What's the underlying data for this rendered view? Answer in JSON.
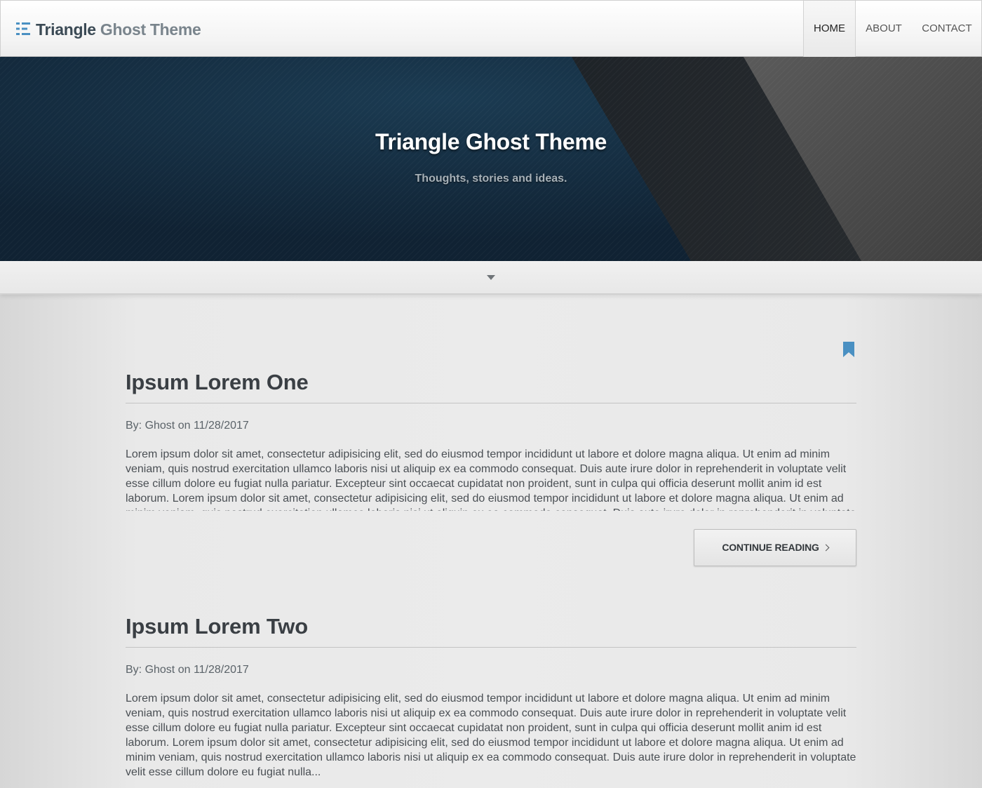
{
  "navbar": {
    "logo_text_dark": "Triangle",
    "logo_text_light": "Ghost Theme",
    "logo_icon": "list-icon",
    "items": [
      {
        "label": "HOME",
        "active": true
      },
      {
        "label": "ABOUT",
        "active": false
      },
      {
        "label": "CONTACT",
        "active": false
      }
    ]
  },
  "hero": {
    "title": "Triangle Ghost Theme",
    "subtitle": "Thoughts, stories and ideas.",
    "scroll_icon": "caret-down-icon"
  },
  "bookmark_icon": "bookmark-icon",
  "posts": [
    {
      "title": "Ipsum Lorem One",
      "meta": "By: Ghost on 11/28/2017",
      "excerpt": "Lorem ipsum dolor sit amet, consectetur adipisicing elit, sed do eiusmod tempor incididunt ut labore et dolore magna aliqua. Ut enim ad minim veniam, quis nostrud exercitation ullamco laboris nisi ut aliquip ex ea commodo consequat. Duis aute irure dolor in reprehenderit in voluptate velit esse cillum dolore eu fugiat nulla pariatur. Excepteur sint occaecat cupidatat non proident, sunt in culpa qui officia deserunt mollit anim id est laborum. Lorem ipsum dolor sit amet, consectetur adipisicing elit, sed do eiusmod tempor incididunt ut labore et dolore magna aliqua. Ut enim ad minim veniam, quis nostrud exercitation ullamco laboris nisi ut aliquip ex ea commodo consequat. Duis aute irure dolor in reprehenderit in voluptate",
      "button_label": "CONTINUE READING"
    },
    {
      "title": "Ipsum Lorem Two",
      "meta": "By: Ghost on 11/28/2017",
      "excerpt": "Lorem ipsum dolor sit amet, consectetur adipisicing elit, sed do eiusmod tempor incididunt ut labore et dolore magna aliqua. Ut enim ad minim veniam, quis nostrud exercitation ullamco laboris nisi ut aliquip ex ea commodo consequat. Duis aute irure dolor in reprehenderit in voluptate velit esse cillum dolore eu fugiat nulla pariatur. Excepteur sint occaecat cupidatat non proident, sunt in culpa qui officia deserunt mollit anim id est laborum. Lorem ipsum dolor sit amet, consectetur adipisicing elit, sed do eiusmod tempor incididunt ut labore et dolore magna aliqua. Ut enim ad minim veniam, quis nostrud exercitation ullamco laboris nisi ut aliquip ex ea commodo consequat. Duis aute irure dolor in reprehenderit in voluptate velit esse cillum dolore eu fugiat nulla..."
    }
  ],
  "colors": {
    "accent": "#4a90c2",
    "hero_dark": "#163246",
    "text": "#4a4f54"
  }
}
